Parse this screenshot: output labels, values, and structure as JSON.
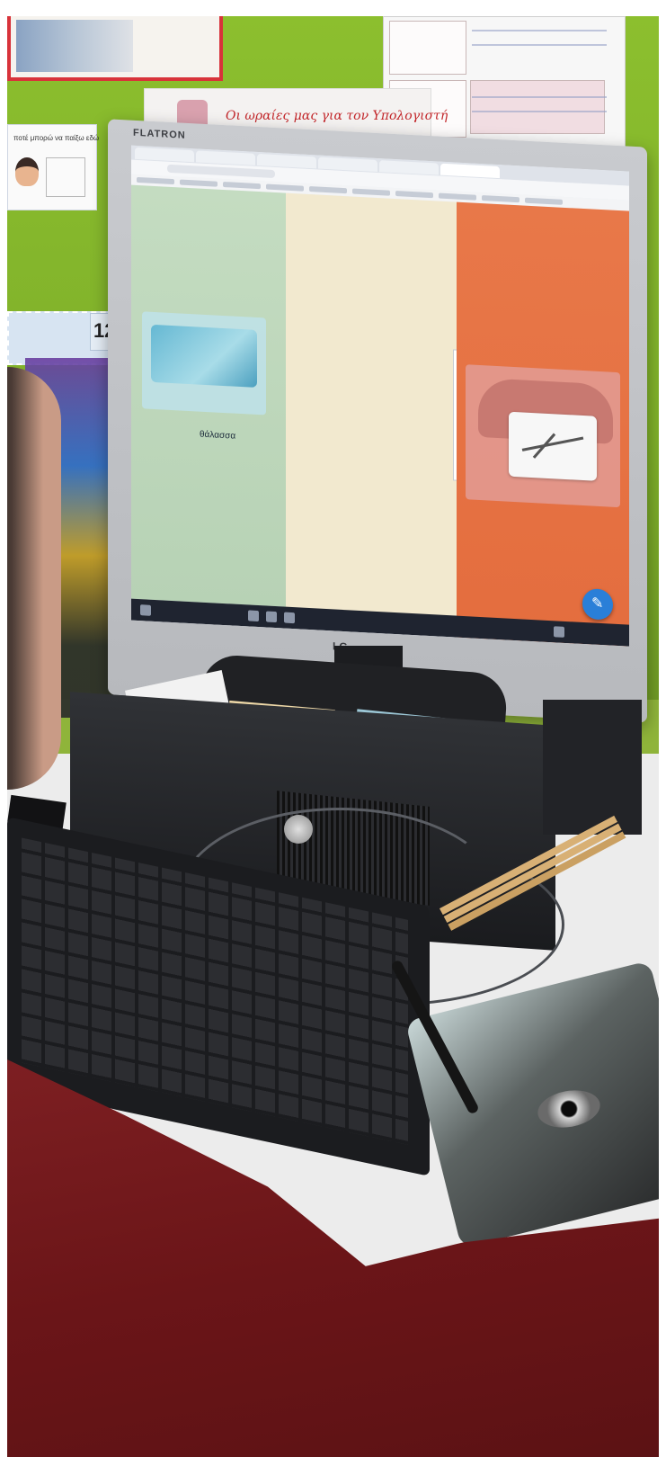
{
  "wall": {
    "poster_caption": "Οι ωραίες μας για τον Υπολογιστή",
    "number_card": "12",
    "small_card_text": "ποτέ μπορώ να παίξω εδώ"
  },
  "monitor": {
    "brand": "FLATRON",
    "logo": "LG"
  },
  "screen": {
    "sea_label": "θάλασσα",
    "colors": {
      "green": "#c4dcc1",
      "beige": "#f2e9cf",
      "orange": "#e87849",
      "edit_button": "#2a7fd8"
    },
    "edit_icon": "pencil-icon"
  }
}
